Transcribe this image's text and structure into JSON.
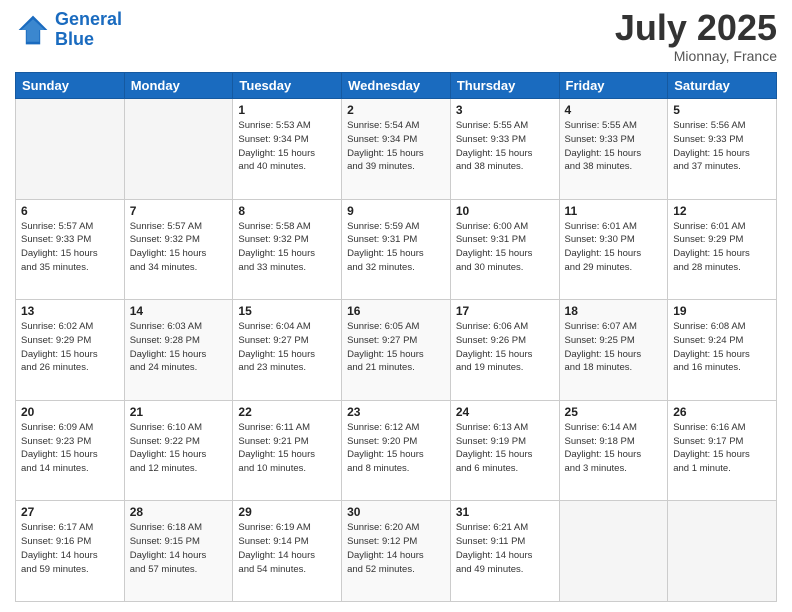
{
  "logo": {
    "line1": "General",
    "line2": "Blue"
  },
  "title": "July 2025",
  "location": "Mionnay, France",
  "days_of_week": [
    "Sunday",
    "Monday",
    "Tuesday",
    "Wednesday",
    "Thursday",
    "Friday",
    "Saturday"
  ],
  "weeks": [
    [
      {
        "day": "",
        "info": ""
      },
      {
        "day": "",
        "info": ""
      },
      {
        "day": "1",
        "info": "Sunrise: 5:53 AM\nSunset: 9:34 PM\nDaylight: 15 hours\nand 40 minutes."
      },
      {
        "day": "2",
        "info": "Sunrise: 5:54 AM\nSunset: 9:34 PM\nDaylight: 15 hours\nand 39 minutes."
      },
      {
        "day": "3",
        "info": "Sunrise: 5:55 AM\nSunset: 9:33 PM\nDaylight: 15 hours\nand 38 minutes."
      },
      {
        "day": "4",
        "info": "Sunrise: 5:55 AM\nSunset: 9:33 PM\nDaylight: 15 hours\nand 38 minutes."
      },
      {
        "day": "5",
        "info": "Sunrise: 5:56 AM\nSunset: 9:33 PM\nDaylight: 15 hours\nand 37 minutes."
      }
    ],
    [
      {
        "day": "6",
        "info": "Sunrise: 5:57 AM\nSunset: 9:33 PM\nDaylight: 15 hours\nand 35 minutes."
      },
      {
        "day": "7",
        "info": "Sunrise: 5:57 AM\nSunset: 9:32 PM\nDaylight: 15 hours\nand 34 minutes."
      },
      {
        "day": "8",
        "info": "Sunrise: 5:58 AM\nSunset: 9:32 PM\nDaylight: 15 hours\nand 33 minutes."
      },
      {
        "day": "9",
        "info": "Sunrise: 5:59 AM\nSunset: 9:31 PM\nDaylight: 15 hours\nand 32 minutes."
      },
      {
        "day": "10",
        "info": "Sunrise: 6:00 AM\nSunset: 9:31 PM\nDaylight: 15 hours\nand 30 minutes."
      },
      {
        "day": "11",
        "info": "Sunrise: 6:01 AM\nSunset: 9:30 PM\nDaylight: 15 hours\nand 29 minutes."
      },
      {
        "day": "12",
        "info": "Sunrise: 6:01 AM\nSunset: 9:29 PM\nDaylight: 15 hours\nand 28 minutes."
      }
    ],
    [
      {
        "day": "13",
        "info": "Sunrise: 6:02 AM\nSunset: 9:29 PM\nDaylight: 15 hours\nand 26 minutes."
      },
      {
        "day": "14",
        "info": "Sunrise: 6:03 AM\nSunset: 9:28 PM\nDaylight: 15 hours\nand 24 minutes."
      },
      {
        "day": "15",
        "info": "Sunrise: 6:04 AM\nSunset: 9:27 PM\nDaylight: 15 hours\nand 23 minutes."
      },
      {
        "day": "16",
        "info": "Sunrise: 6:05 AM\nSunset: 9:27 PM\nDaylight: 15 hours\nand 21 minutes."
      },
      {
        "day": "17",
        "info": "Sunrise: 6:06 AM\nSunset: 9:26 PM\nDaylight: 15 hours\nand 19 minutes."
      },
      {
        "day": "18",
        "info": "Sunrise: 6:07 AM\nSunset: 9:25 PM\nDaylight: 15 hours\nand 18 minutes."
      },
      {
        "day": "19",
        "info": "Sunrise: 6:08 AM\nSunset: 9:24 PM\nDaylight: 15 hours\nand 16 minutes."
      }
    ],
    [
      {
        "day": "20",
        "info": "Sunrise: 6:09 AM\nSunset: 9:23 PM\nDaylight: 15 hours\nand 14 minutes."
      },
      {
        "day": "21",
        "info": "Sunrise: 6:10 AM\nSunset: 9:22 PM\nDaylight: 15 hours\nand 12 minutes."
      },
      {
        "day": "22",
        "info": "Sunrise: 6:11 AM\nSunset: 9:21 PM\nDaylight: 15 hours\nand 10 minutes."
      },
      {
        "day": "23",
        "info": "Sunrise: 6:12 AM\nSunset: 9:20 PM\nDaylight: 15 hours\nand 8 minutes."
      },
      {
        "day": "24",
        "info": "Sunrise: 6:13 AM\nSunset: 9:19 PM\nDaylight: 15 hours\nand 6 minutes."
      },
      {
        "day": "25",
        "info": "Sunrise: 6:14 AM\nSunset: 9:18 PM\nDaylight: 15 hours\nand 3 minutes."
      },
      {
        "day": "26",
        "info": "Sunrise: 6:16 AM\nSunset: 9:17 PM\nDaylight: 15 hours\nand 1 minute."
      }
    ],
    [
      {
        "day": "27",
        "info": "Sunrise: 6:17 AM\nSunset: 9:16 PM\nDaylight: 14 hours\nand 59 minutes."
      },
      {
        "day": "28",
        "info": "Sunrise: 6:18 AM\nSunset: 9:15 PM\nDaylight: 14 hours\nand 57 minutes."
      },
      {
        "day": "29",
        "info": "Sunrise: 6:19 AM\nSunset: 9:14 PM\nDaylight: 14 hours\nand 54 minutes."
      },
      {
        "day": "30",
        "info": "Sunrise: 6:20 AM\nSunset: 9:12 PM\nDaylight: 14 hours\nand 52 minutes."
      },
      {
        "day": "31",
        "info": "Sunrise: 6:21 AM\nSunset: 9:11 PM\nDaylight: 14 hours\nand 49 minutes."
      },
      {
        "day": "",
        "info": ""
      },
      {
        "day": "",
        "info": ""
      }
    ]
  ]
}
